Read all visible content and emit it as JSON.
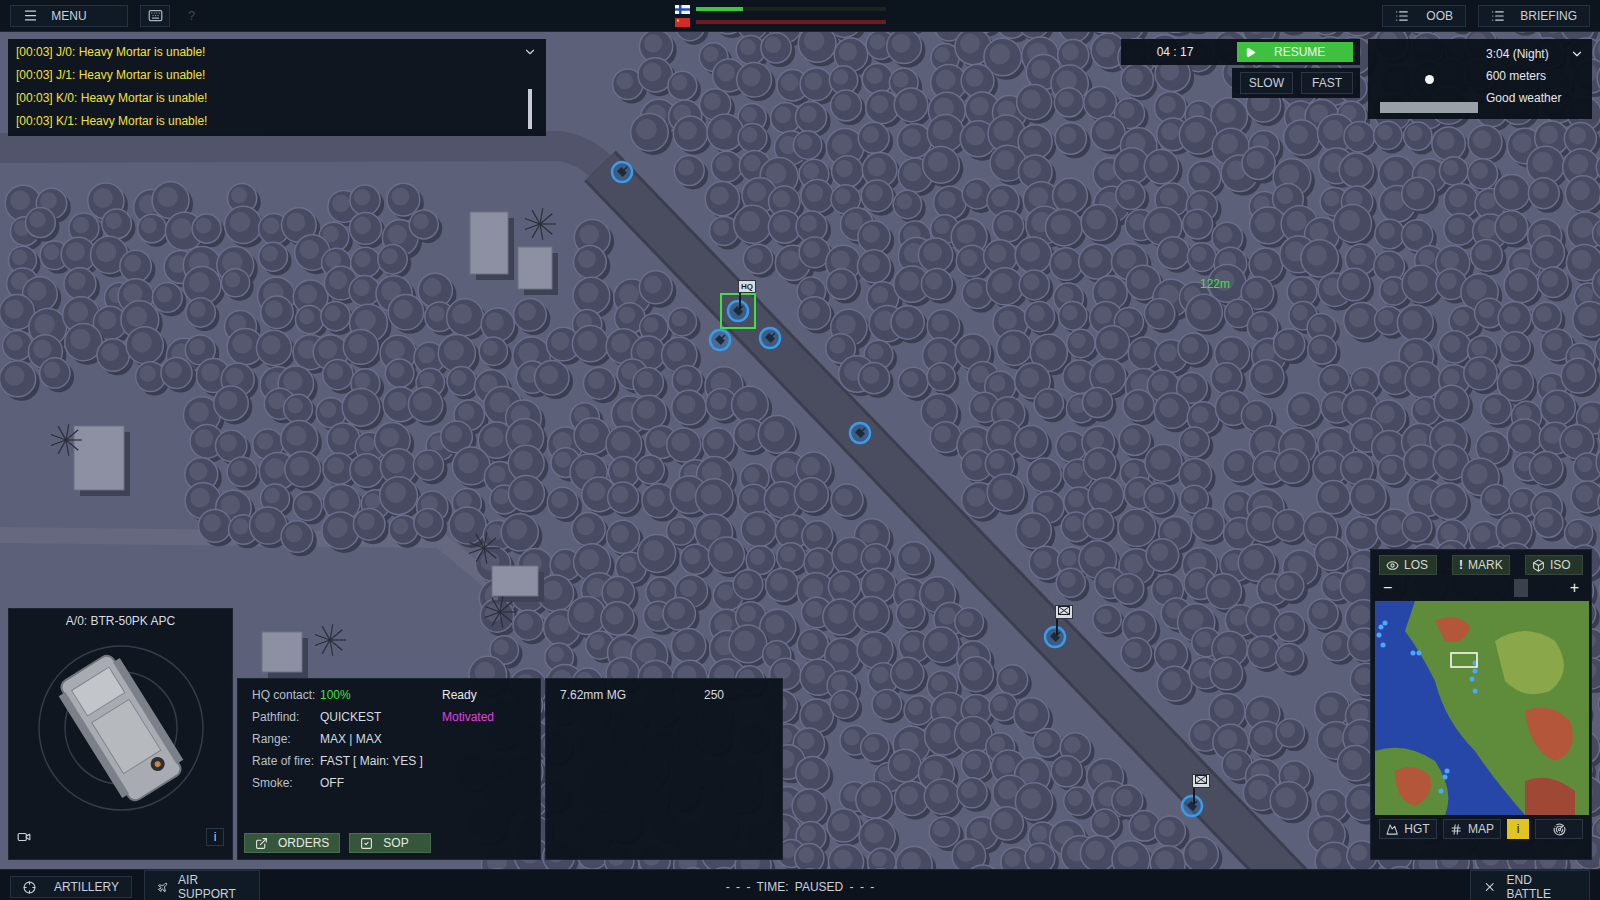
{
  "top_bar": {
    "menu": "MENU",
    "help": "?",
    "oob": "OOB",
    "briefing": "BRIEFING",
    "sides": [
      {
        "kind": "finland",
        "color": "#3fc73f",
        "level": 0.25
      },
      {
        "kind": "soviet",
        "color": "#6e1a1e",
        "level": 1
      }
    ]
  },
  "messages": [
    "[00:03] J/0: Heavy Mortar is unable!",
    "[00:03] J/1: Heavy Mortar is unable!",
    "[00:03] K/0: Heavy Mortar is unable!",
    "[00:03] K/1: Heavy Mortar is unable!"
  ],
  "clock": {
    "time": "04 : 17",
    "resume": "RESUME",
    "resume_active": true,
    "speeds": [
      {
        "label": "SLOW",
        "selected": false
      },
      {
        "label": "FAST",
        "selected": false
      }
    ]
  },
  "weather": {
    "time": "3:04 (Night)",
    "visibility": "600 meters",
    "conditions": "Good weather",
    "light_level": 1
  },
  "map": {
    "distance": "122m",
    "units": [
      {
        "kind": "plain",
        "selected": false
      },
      {
        "kind": "hq",
        "label": "HQ",
        "selected": true
      },
      {
        "kind": "plain",
        "selected": false
      },
      {
        "kind": "plain",
        "selected": false
      },
      {
        "kind": "plain",
        "selected": false
      },
      {
        "kind": "flagged",
        "selected": false
      },
      {
        "kind": "flagged",
        "selected": false
      }
    ]
  },
  "unit_panel": {
    "title": "A/0: BTR-50PK APC",
    "info": "i"
  },
  "info_panel": {
    "rows": [
      {
        "label": "HQ contact:",
        "value": "100%",
        "value_color": "#3ee23e",
        "status": "Ready",
        "status_color": "#e8e8e8"
      },
      {
        "label": "Pathfind:",
        "value": "QUICKEST",
        "status": "Motivated",
        "status_color": "#e040e0"
      },
      {
        "label": "Range:",
        "value": "MAX | MAX"
      },
      {
        "label": "Rate of fire:",
        "value": "FAST [ Main: YES ]"
      },
      {
        "label": "Smoke:",
        "value": "OFF"
      }
    ],
    "buttons": [
      "ORDERS",
      "SOP"
    ]
  },
  "weapons": [
    {
      "name": "7.62mm MG",
      "ammo": "250"
    }
  ],
  "minimap": {
    "tools": [
      {
        "label": "LOS"
      },
      {
        "label": "MARK",
        "glyph": "!"
      },
      {
        "label": "ISO"
      }
    ],
    "zoom_out": "−",
    "zoom_in": "+",
    "zoom_level": 0.75,
    "bottom": [
      {
        "label": "HGT",
        "selected": false
      },
      {
        "label": "MAP",
        "selected": false
      },
      {
        "label": "i",
        "selected": true
      },
      {
        "label": "",
        "selected": false
      }
    ]
  },
  "bottom_bar": {
    "artillery": "ARTILLERY",
    "air_support": "AIR SUPPORT",
    "status": "- - - TIME: PAUSED - - -",
    "end": "END BATTLE"
  }
}
